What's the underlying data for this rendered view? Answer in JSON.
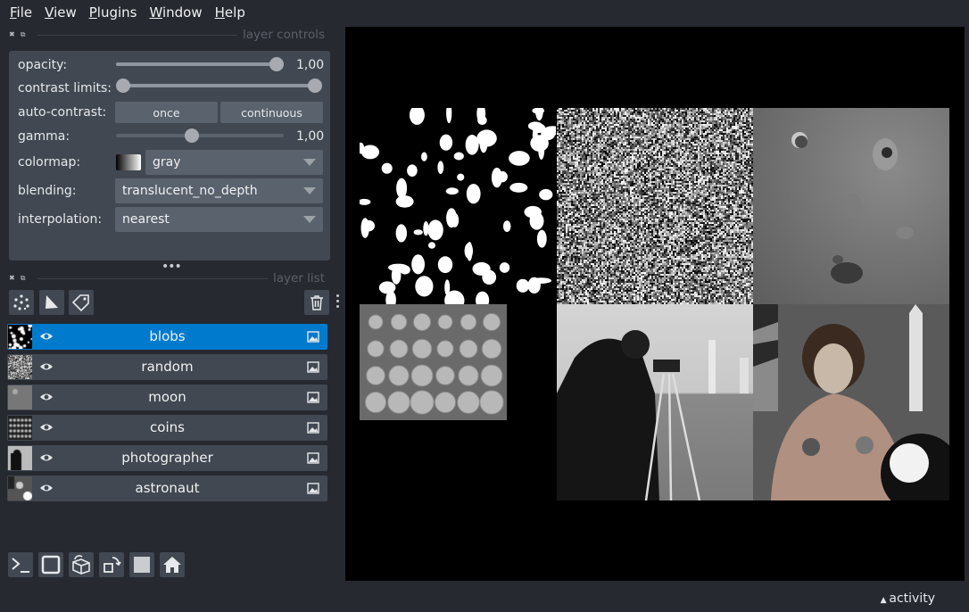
{
  "menu": [
    "File",
    "View",
    "Plugins",
    "Window",
    "Help"
  ],
  "layer_controls": {
    "title": "layer controls",
    "opacity": {
      "label": "opacity:",
      "value": "1,00",
      "level": 1.0
    },
    "contrast_limits": {
      "label": "contrast limits:",
      "low": 0.0,
      "high": 1.0
    },
    "auto_contrast": {
      "label": "auto-contrast:",
      "once": "once",
      "continuous": "continuous"
    },
    "gamma": {
      "label": "gamma:",
      "value": "1,00",
      "level": 0.45
    },
    "colormap": {
      "label": "colormap:",
      "value": "gray"
    },
    "blending": {
      "label": "blending:",
      "value": "translucent_no_depth"
    },
    "interpolation": {
      "label": "interpolation:",
      "value": "nearest"
    }
  },
  "layer_list": {
    "title": "layer list",
    "layers": [
      {
        "name": "blobs",
        "selected": true
      },
      {
        "name": "random",
        "selected": false
      },
      {
        "name": "moon",
        "selected": false
      },
      {
        "name": "coins",
        "selected": false
      },
      {
        "name": "photographer",
        "selected": false
      },
      {
        "name": "astronaut",
        "selected": false
      }
    ]
  },
  "icons": {
    "tools": [
      "new-points-icon",
      "new-shapes-icon",
      "new-labels-icon",
      "delete-layer-icon"
    ],
    "bottom": [
      "console-icon",
      "ndisplay-icon",
      "roll-dims-icon",
      "transpose-icon",
      "grid-icon",
      "home-icon"
    ]
  },
  "colors": {
    "selected": "#007acc",
    "panel": "#414851",
    "background": "#262930"
  },
  "status": {
    "activity": "activity"
  }
}
